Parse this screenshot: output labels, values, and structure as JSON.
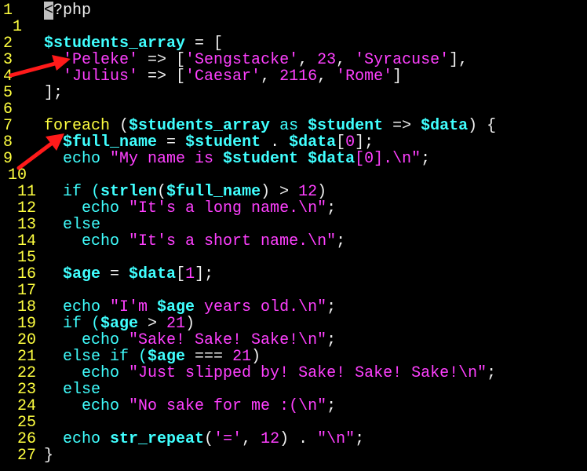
{
  "colors": {
    "background": "#000000",
    "line_number": "#ffff40",
    "default": "#f0f0f0",
    "variable": "#40ffff",
    "string": "#ff40ff",
    "keyword": "#40ffff",
    "function": "#40ffff",
    "operator": "#ffff40",
    "number": "#ff40ff",
    "arrow": "#ff1a1a"
  },
  "editor": {
    "lines": [
      {
        "num": "1",
        "tokens": [
          {
            "t": "<",
            "c": "cursor"
          },
          {
            "t": "?php",
            "c": "default"
          }
        ]
      },
      {
        "num": "1",
        "tokens": []
      },
      {
        "num": "2",
        "tokens": [
          {
            "t": "$students_array",
            "c": "variable",
            "b": true
          },
          {
            "t": " = [",
            "c": "default"
          }
        ]
      },
      {
        "num": "3",
        "tokens": [
          {
            "t": "  'Peleke'",
            "c": "string"
          },
          {
            "t": " => [",
            "c": "default"
          },
          {
            "t": "'Sengstacke'",
            "c": "string"
          },
          {
            "t": ", ",
            "c": "default"
          },
          {
            "t": "23",
            "c": "number"
          },
          {
            "t": ", ",
            "c": "default"
          },
          {
            "t": "'Syracuse'",
            "c": "string"
          },
          {
            "t": "],",
            "c": "default"
          }
        ]
      },
      {
        "num": "4",
        "tokens": [
          {
            "t": "  'Julius'",
            "c": "string"
          },
          {
            "t": " => [",
            "c": "default"
          },
          {
            "t": "'Caesar'",
            "c": "string"
          },
          {
            "t": ", ",
            "c": "default"
          },
          {
            "t": "2116",
            "c": "number"
          },
          {
            "t": ", ",
            "c": "default"
          },
          {
            "t": "'Rome'",
            "c": "string"
          },
          {
            "t": "]",
            "c": "default"
          }
        ]
      },
      {
        "num": "5",
        "tokens": [
          {
            "t": "];",
            "c": "default"
          }
        ]
      },
      {
        "num": "6",
        "tokens": []
      },
      {
        "num": "7",
        "tokens": [
          {
            "t": "foreach",
            "c": "operator"
          },
          {
            "t": " (",
            "c": "default"
          },
          {
            "t": "$students_array",
            "c": "variable",
            "b": true
          },
          {
            "t": " as ",
            "c": "keyword"
          },
          {
            "t": "$student",
            "c": "variable",
            "b": true
          },
          {
            "t": " => ",
            "c": "default"
          },
          {
            "t": "$data",
            "c": "variable",
            "b": true
          },
          {
            "t": ") {",
            "c": "default"
          }
        ]
      },
      {
        "num": "8",
        "tokens": [
          {
            "t": "  ",
            "c": "default"
          },
          {
            "t": "$full_name",
            "c": "variable",
            "b": true
          },
          {
            "t": " = ",
            "c": "default"
          },
          {
            "t": "$student",
            "c": "variable",
            "b": true
          },
          {
            "t": " . ",
            "c": "default"
          },
          {
            "t": "$data",
            "c": "variable",
            "b": true
          },
          {
            "t": "[",
            "c": "default"
          },
          {
            "t": "0",
            "c": "number"
          },
          {
            "t": "];",
            "c": "default"
          }
        ]
      },
      {
        "num": "9",
        "tokens": [
          {
            "t": "  echo ",
            "c": "keyword"
          },
          {
            "t": "\"My name is ",
            "c": "string"
          },
          {
            "t": "$student",
            "c": "variable",
            "b": true
          },
          {
            "t": " ",
            "c": "string"
          },
          {
            "t": "$data",
            "c": "variable",
            "b": true
          },
          {
            "t": "[",
            "c": "string"
          },
          {
            "t": "0",
            "c": "number"
          },
          {
            "t": "].\\n\"",
            "c": "string"
          },
          {
            "t": ";",
            "c": "default"
          }
        ]
      },
      {
        "num": "10",
        "tokens": []
      },
      {
        "num": "11",
        "tokens": [
          {
            "t": "  if (",
            "c": "keyword"
          },
          {
            "t": "strlen",
            "c": "function",
            "b": true
          },
          {
            "t": "(",
            "c": "default"
          },
          {
            "t": "$full_name",
            "c": "variable",
            "b": true
          },
          {
            "t": ") > ",
            "c": "default"
          },
          {
            "t": "12",
            "c": "number"
          },
          {
            "t": ")",
            "c": "default"
          }
        ]
      },
      {
        "num": "12",
        "tokens": [
          {
            "t": "    echo ",
            "c": "keyword"
          },
          {
            "t": "\"It's a long name.\\n\"",
            "c": "string"
          },
          {
            "t": ";",
            "c": "default"
          }
        ]
      },
      {
        "num": "13",
        "tokens": [
          {
            "t": "  else",
            "c": "keyword"
          }
        ]
      },
      {
        "num": "14",
        "tokens": [
          {
            "t": "    echo ",
            "c": "keyword"
          },
          {
            "t": "\"It's a short name.\\n\"",
            "c": "string"
          },
          {
            "t": ";",
            "c": "default"
          }
        ]
      },
      {
        "num": "15",
        "tokens": []
      },
      {
        "num": "16",
        "tokens": [
          {
            "t": "  ",
            "c": "default"
          },
          {
            "t": "$age",
            "c": "variable",
            "b": true
          },
          {
            "t": " = ",
            "c": "default"
          },
          {
            "t": "$data",
            "c": "variable",
            "b": true
          },
          {
            "t": "[",
            "c": "default"
          },
          {
            "t": "1",
            "c": "number"
          },
          {
            "t": "];",
            "c": "default"
          }
        ]
      },
      {
        "num": "17",
        "tokens": []
      },
      {
        "num": "18",
        "tokens": [
          {
            "t": "  echo ",
            "c": "keyword"
          },
          {
            "t": "\"I'm ",
            "c": "string"
          },
          {
            "t": "$age",
            "c": "variable",
            "b": true
          },
          {
            "t": " years old.\\n\"",
            "c": "string"
          },
          {
            "t": ";",
            "c": "default"
          }
        ]
      },
      {
        "num": "19",
        "tokens": [
          {
            "t": "  if (",
            "c": "keyword"
          },
          {
            "t": "$age",
            "c": "variable",
            "b": true
          },
          {
            "t": " > ",
            "c": "default"
          },
          {
            "t": "21",
            "c": "number"
          },
          {
            "t": ")",
            "c": "default"
          }
        ]
      },
      {
        "num": "20",
        "tokens": [
          {
            "t": "    echo ",
            "c": "keyword"
          },
          {
            "t": "\"Sake! Sake! Sake!\\n\"",
            "c": "string"
          },
          {
            "t": ";",
            "c": "default"
          }
        ]
      },
      {
        "num": "21",
        "tokens": [
          {
            "t": "  else if (",
            "c": "keyword"
          },
          {
            "t": "$age",
            "c": "variable",
            "b": true
          },
          {
            "t": " === ",
            "c": "default"
          },
          {
            "t": "21",
            "c": "number"
          },
          {
            "t": ")",
            "c": "default"
          }
        ]
      },
      {
        "num": "22",
        "tokens": [
          {
            "t": "    echo ",
            "c": "keyword"
          },
          {
            "t": "\"Just slipped by! Sake! Sake! Sake!\\n\"",
            "c": "string"
          },
          {
            "t": ";",
            "c": "default"
          }
        ]
      },
      {
        "num": "23",
        "tokens": [
          {
            "t": "  else",
            "c": "keyword"
          }
        ]
      },
      {
        "num": "24",
        "tokens": [
          {
            "t": "    echo ",
            "c": "keyword"
          },
          {
            "t": "\"No sake for me :(\\n\"",
            "c": "string"
          },
          {
            "t": ";",
            "c": "default"
          }
        ]
      },
      {
        "num": "25",
        "tokens": []
      },
      {
        "num": "26",
        "tokens": [
          {
            "t": "  echo ",
            "c": "keyword"
          },
          {
            "t": "str_repeat",
            "c": "function",
            "b": true
          },
          {
            "t": "(",
            "c": "default"
          },
          {
            "t": "'='",
            "c": "string"
          },
          {
            "t": ", ",
            "c": "default"
          },
          {
            "t": "12",
            "c": "number"
          },
          {
            "t": ") . ",
            "c": "default"
          },
          {
            "t": "\"\\n\"",
            "c": "string"
          },
          {
            "t": ";",
            "c": "default"
          }
        ]
      },
      {
        "num": "27",
        "tokens": [
          {
            "t": "}",
            "c": "default"
          }
        ]
      }
    ]
  },
  "annotations": [
    {
      "name": "arrow-annotation-line-3",
      "icon": "red-arrow-icon"
    },
    {
      "name": "arrow-annotation-line-8",
      "icon": "red-arrow-icon"
    }
  ]
}
